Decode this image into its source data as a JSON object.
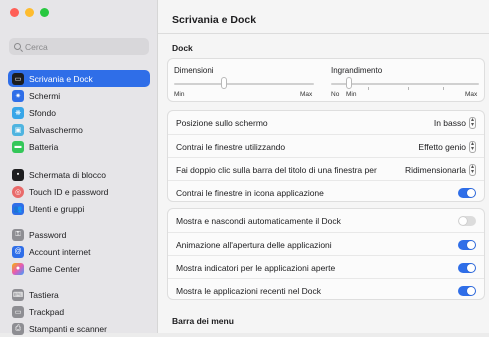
{
  "sidebar": {
    "search_placeholder": "Cerca",
    "items": [
      {
        "label": "Scrivania e Dock",
        "icon": "dock-icon",
        "color": "#1d1d1f",
        "active": true
      },
      {
        "label": "Schermi",
        "icon": "display-icon",
        "color": "#2f6ee8"
      },
      {
        "label": "Sfondo",
        "icon": "wallpaper-icon",
        "color": "#38a6e8"
      },
      {
        "label": "Salvaschermo",
        "icon": "screensaver-icon",
        "color": "#4fb4e0"
      },
      {
        "label": "Batteria",
        "icon": "battery-icon",
        "color": "#34c759"
      },
      {
        "label": "Schermata di blocco",
        "icon": "lock-screen-icon",
        "color": "#1d1d1f"
      },
      {
        "label": "Touch ID e password",
        "icon": "fingerprint-icon",
        "color": "#e96a6a"
      },
      {
        "label": "Utenti e gruppi",
        "icon": "users-icon",
        "color": "#2f6ee8"
      },
      {
        "label": "Password",
        "icon": "key-icon",
        "color": "#8e8e93"
      },
      {
        "label": "Account internet",
        "icon": "at-icon",
        "color": "#2f6ee8"
      },
      {
        "label": "Game Center",
        "icon": "game-center-icon",
        "color": "#e65bb4"
      },
      {
        "label": "Tastiera",
        "icon": "keyboard-icon",
        "color": "#8e8e93"
      },
      {
        "label": "Trackpad",
        "icon": "trackpad-icon",
        "color": "#8e8e93"
      },
      {
        "label": "Stampanti e scanner",
        "icon": "printer-icon",
        "color": "#8e8e93"
      }
    ]
  },
  "main": {
    "title": "Scrivania e Dock",
    "dock_section": "Dock",
    "size": {
      "label": "Dimensioni",
      "min": "Min",
      "max": "Max",
      "value": 0.35
    },
    "magnification": {
      "label": "Ingrandimento",
      "no": "No",
      "min": "Min",
      "max": "Max",
      "value": 0.0
    },
    "settings": [
      {
        "label": "Posizione sullo schermo",
        "value": "In basso"
      },
      {
        "label": "Contrai le finestre utilizzando",
        "value": "Effetto genio"
      },
      {
        "label": "Fai doppio clic sulla barra del titolo di una finestra per",
        "value": "Ridimensionarla"
      },
      {
        "label": "Contrai le finestre in icona applicazione",
        "toggle": true
      }
    ],
    "toggles": [
      {
        "label": "Mostra e nascondi automaticamente il Dock",
        "on": false
      },
      {
        "label": "Animazione all'apertura delle applicazioni",
        "on": true
      },
      {
        "label": "Mostra indicatori per le applicazioni aperte",
        "on": true
      },
      {
        "label": "Mostra le applicazioni recenti nel Dock",
        "on": true
      }
    ],
    "menu_bar_section": "Barra dei menu"
  }
}
